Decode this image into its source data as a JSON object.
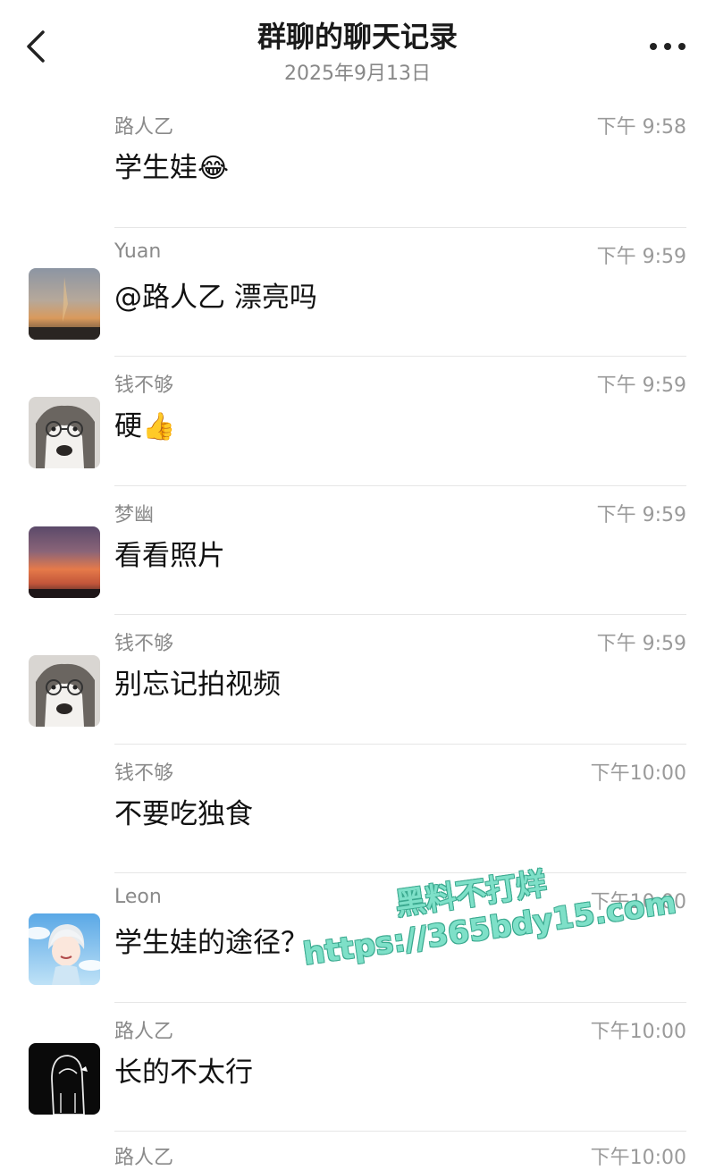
{
  "header": {
    "title": "群聊的聊天记录",
    "date": "2025年9月13日"
  },
  "messages": [
    {
      "sender": "路人乙",
      "time": "下午 9:58",
      "text": "学生娃",
      "emoji": "😂",
      "avatar": "none"
    },
    {
      "sender": "Yuan",
      "time": "下午 9:59",
      "text": "@路人乙 漂亮吗",
      "emoji": "",
      "avatar": "dusk-sky"
    },
    {
      "sender": "钱不够",
      "time": "下午 9:59",
      "text": "硬",
      "emoji": "👍",
      "avatar": "husky"
    },
    {
      "sender": "梦幽",
      "time": "下午 9:59",
      "text": "看看照片",
      "emoji": "",
      "avatar": "sunset"
    },
    {
      "sender": "钱不够",
      "time": "下午 9:59",
      "text": "别忘记拍视频",
      "emoji": "",
      "avatar": "husky"
    },
    {
      "sender": "钱不够",
      "time": "下午10:00",
      "text": "不要吃独食",
      "emoji": "",
      "avatar": "none"
    },
    {
      "sender": "Leon",
      "time": "下午10:00",
      "text": "学生娃的途径？",
      "emoji": "",
      "avatar": "anime-boy"
    },
    {
      "sender": "路人乙",
      "time": "下午10:00",
      "text": "长的不太行",
      "emoji": "",
      "avatar": "hooded-figure"
    }
  ],
  "partial": {
    "sender": "路人乙",
    "time": "下午10:00"
  },
  "watermark": {
    "line1": "黑料不打烊",
    "line2": "https://365bdy15.com"
  },
  "icons": {
    "back": "chevron-left-icon",
    "more": "more-dots-icon"
  }
}
